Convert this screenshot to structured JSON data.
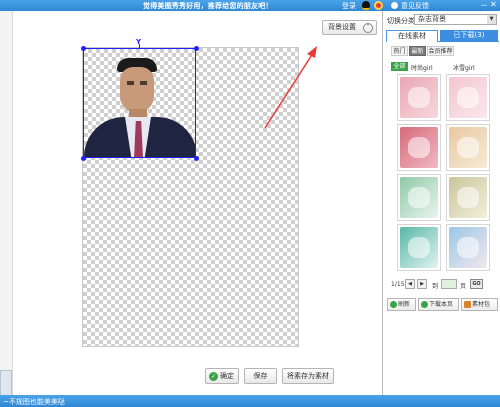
{
  "titlebar": {
    "message": "觉得美图秀秀好用，推荐给您的朋友吧！",
    "login": "登录",
    "feedback": "意见反馈",
    "minimize": "－",
    "close": "✕"
  },
  "canvas": {
    "background_settings_label": "背景设置",
    "rotate_handle_glyph": "Y",
    "buttons": {
      "ok": "确定",
      "save": "保存",
      "save_as_material": "将素存为素材"
    }
  },
  "panel": {
    "category_label": "切换分类",
    "category_value": "杂志背景",
    "tabs": {
      "online": "在线素材",
      "downloaded": "已下载(3)"
    },
    "subtabs": [
      "热门",
      "最新",
      "会员推荐"
    ],
    "filters": [
      "全部",
      "时尚girl",
      "冰雪girl"
    ],
    "thumbnails": [
      {
        "color_a": "#e9a7b3",
        "color_b": "#f8d7dd",
        "name": "magazine-bg-1"
      },
      {
        "color_a": "#f3c6d0",
        "color_b": "#fbe7ec",
        "name": "magazine-bg-2"
      },
      {
        "color_a": "#d66a7a",
        "color_b": "#f2b9c3",
        "name": "magazine-bg-3"
      },
      {
        "color_a": "#e8c9a1",
        "color_b": "#f7ead7",
        "name": "magazine-bg-4"
      },
      {
        "color_a": "#8fc9a6",
        "color_b": "#eaf5ee",
        "name": "magazine-bg-5"
      },
      {
        "color_a": "#c9c59b",
        "color_b": "#f2efdc",
        "name": "magazine-bg-6"
      },
      {
        "color_a": "#57b7a8",
        "color_b": "#e3f3ef",
        "name": "magazine-bg-7"
      },
      {
        "color_a": "#9ac7e6",
        "color_b": "#f3e7ee",
        "name": "magazine-bg-8"
      }
    ],
    "pager": {
      "page_info": "1/15",
      "prev": "◀",
      "next": "▶",
      "to_label": "到",
      "page_label": "页",
      "go": "GO"
    },
    "actions": {
      "refresh": "刷新",
      "download_page": "下载本页",
      "material_pack": "素材包"
    }
  },
  "bottombar": {
    "text": "~不规图也能美美哒"
  }
}
